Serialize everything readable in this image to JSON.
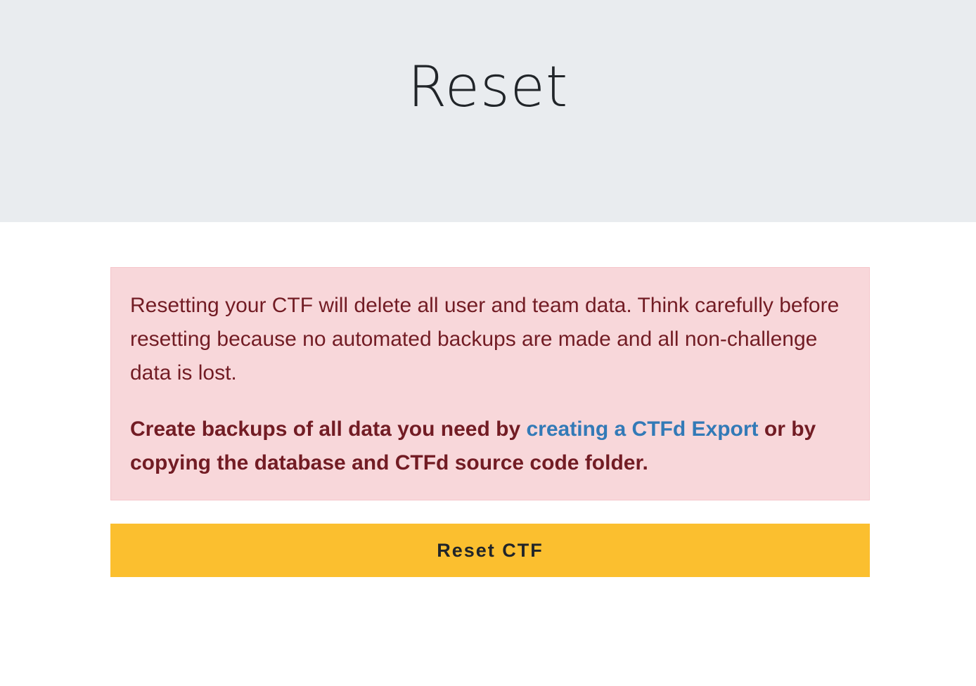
{
  "header": {
    "title": "Reset"
  },
  "alert": {
    "warning": "Resetting your CTF will delete all user and team data. Think carefully before resetting because no automated backups are made and all non-challenge data is lost.",
    "backup_prefix": "Create backups of all data you need by ",
    "export_link": "creating a CTFd Export",
    "backup_suffix": " or by copying the database and CTFd source code folder."
  },
  "actions": {
    "reset_label": "Reset CTF"
  },
  "colors": {
    "header_bg": "#e9ecef",
    "alert_bg": "#f8d7da",
    "alert_text": "#721c24",
    "link": "#337ab7",
    "button_bg": "#fbbf2f"
  }
}
